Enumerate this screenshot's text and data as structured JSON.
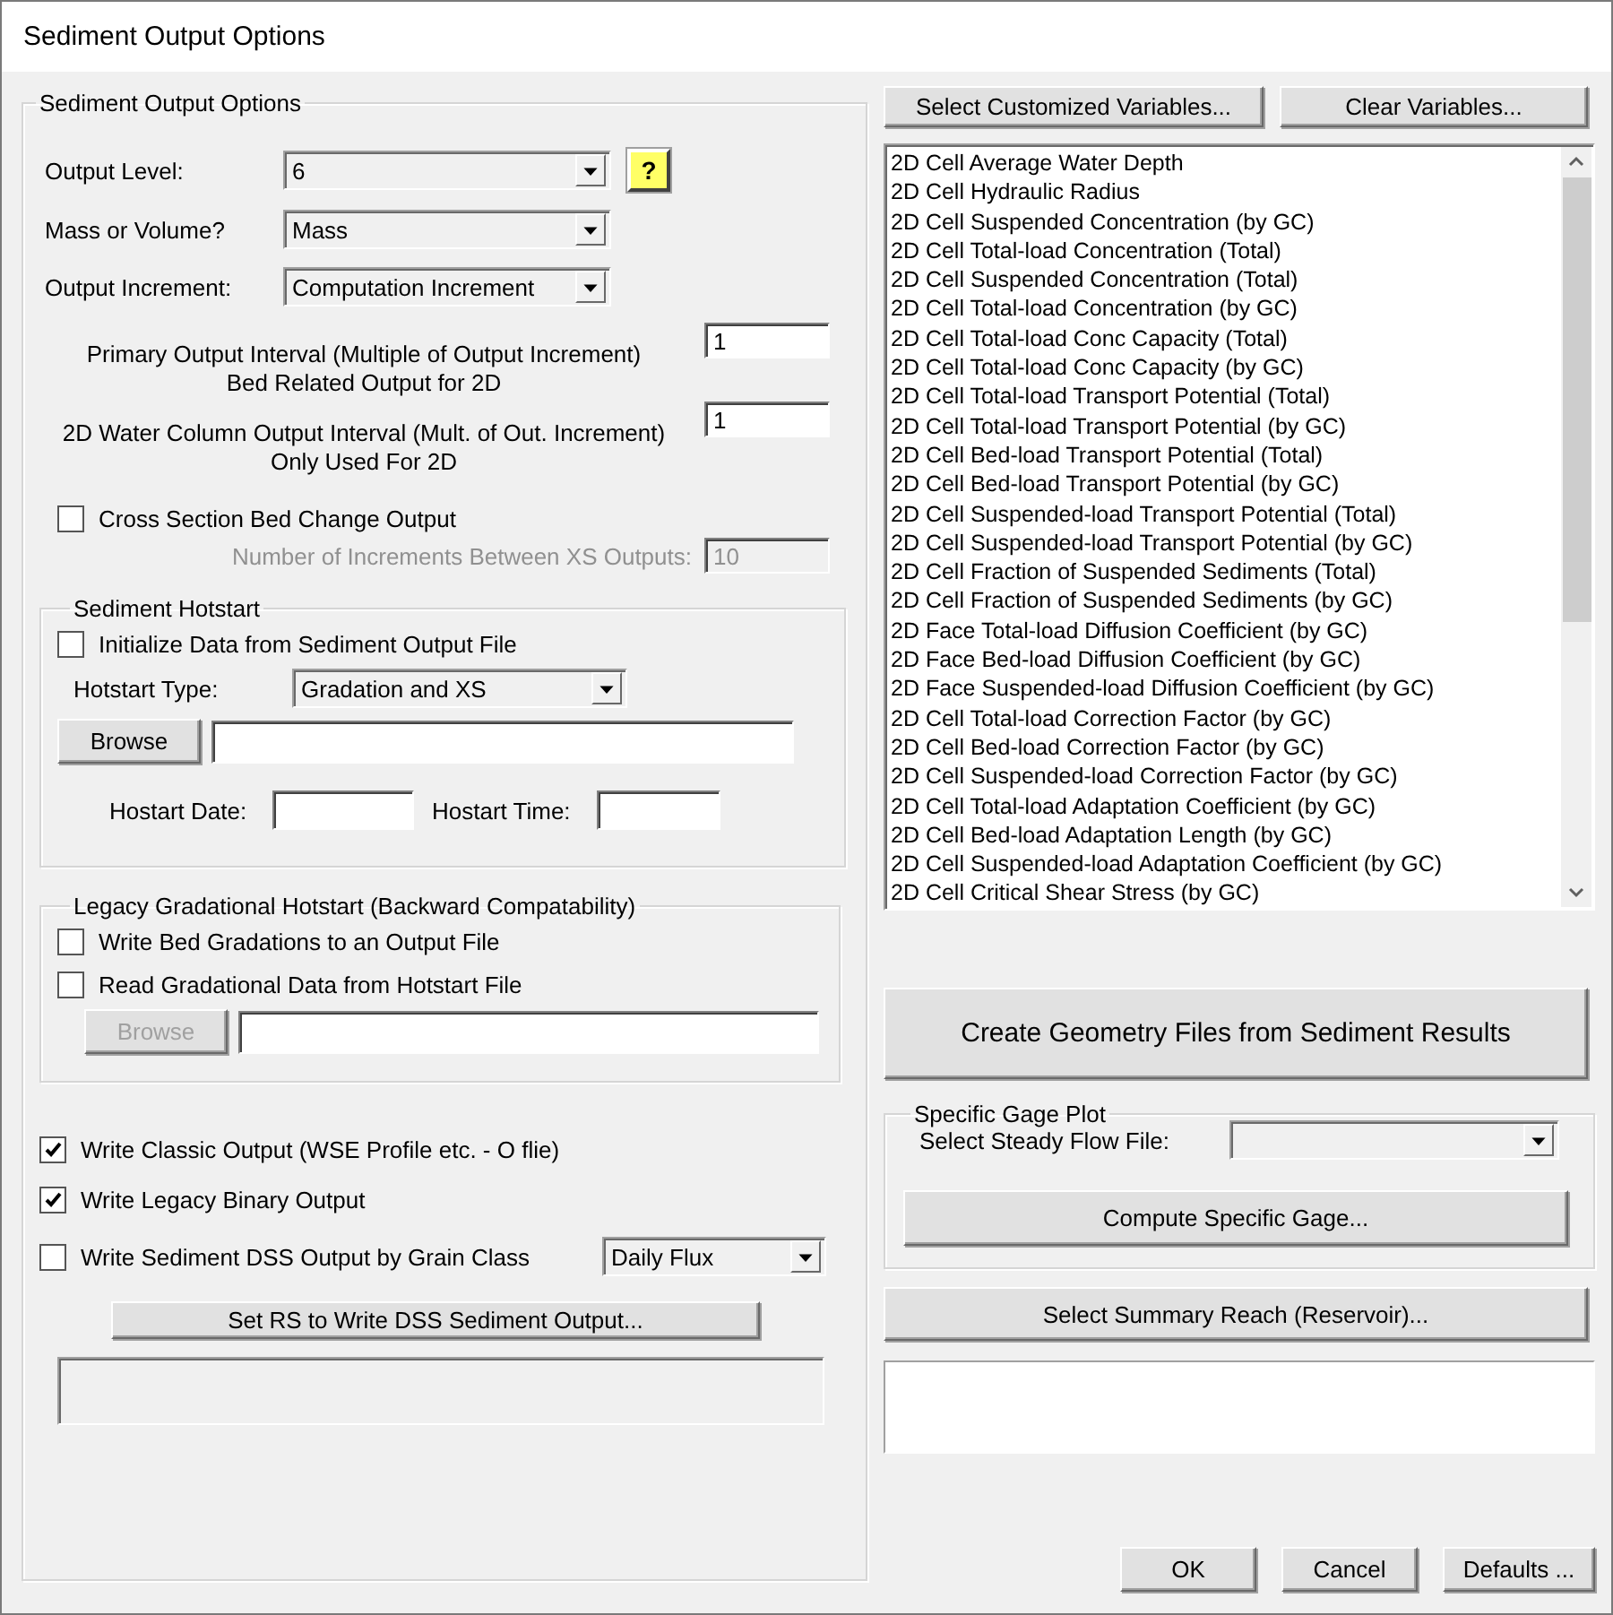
{
  "window": {
    "title": "Sediment Output Options"
  },
  "output_options": {
    "title": "Sediment Output Options",
    "output_level": {
      "label": "Output Level:",
      "value": "6",
      "help_button": "?"
    },
    "mass_or_volume": {
      "label": "Mass or Volume?",
      "value": "Mass"
    },
    "output_increment": {
      "label": "Output Increment:",
      "value": "Computation Increment"
    },
    "primary_interval": {
      "label_lines": [
        "Primary Output Interval (Multiple of Output Increment)",
        "Bed Related Output for 2D"
      ],
      "value": "1"
    },
    "water_column_interval": {
      "label_lines": [
        "2D Water Column Output Interval (Mult. of Out. Increment)",
        "Only Used For 2D"
      ],
      "value": "1"
    },
    "xs_bed_change": {
      "label": "Cross Section Bed Change Output",
      "checked": false
    },
    "xs_increments": {
      "label": "Number of Increments Between XS Outputs:",
      "value": "10",
      "disabled": true
    }
  },
  "hotstart": {
    "title": "Sediment Hotstart",
    "initialize": {
      "label": "Initialize Data from Sediment Output File",
      "checked": false
    },
    "type_label": "Hotstart Type:",
    "type_value": "Gradation and XS",
    "browse_button": "Browse",
    "date_label": "Hostart Date:",
    "time_label": "Hostart Time:"
  },
  "legacy_hotstart": {
    "title": "Legacy Gradational Hotstart (Backward Compatability)",
    "options": [
      {
        "label": "Write Bed Gradations to an Output File",
        "checked": false
      },
      {
        "label": "Read Gradational Data from Hotstart File",
        "checked": false
      }
    ],
    "browse_button": {
      "label": "Browse",
      "disabled": true
    }
  },
  "outputs": [
    {
      "label": "Write Classic Output (WSE Profile etc. - O flie)",
      "checked": true
    },
    {
      "label": "Write Legacy Binary Output",
      "checked": true
    },
    {
      "label": "Write Sediment DSS Output by Grain Class",
      "checked": false,
      "dropdown": "Daily Flux"
    }
  ],
  "set_rs_button": "Set RS to Write DSS Sediment Output...",
  "variable_buttons": [
    "Select Customized Variables...",
    "Clear Variables..."
  ],
  "variables": [
    "2D Cell Average Water Depth",
    "2D Cell Hydraulic Radius",
    "2D Cell Suspended Concentration (by GC)",
    "2D Cell Total-load Concentration (Total)",
    "2D Cell Suspended Concentration (Total)",
    "2D Cell Total-load Concentration (by GC)",
    "2D Cell Total-load Conc Capacity (Total)",
    "2D Cell Total-load Conc Capacity (by GC)",
    "2D Cell Total-load Transport Potential (Total)",
    "2D Cell Total-load Transport Potential (by GC)",
    "2D Cell Bed-load Transport Potential (Total)",
    "2D Cell Bed-load Transport Potential (by GC)",
    "2D Cell Suspended-load Transport Potential (Total)",
    "2D Cell Suspended-load Transport Potential (by GC)",
    "2D Cell Fraction of Suspended Sediments (Total)",
    "2D Cell Fraction of Suspended Sediments (by GC)",
    "2D Face Total-load Diffusion Coefficient (by GC)",
    "2D Face Bed-load Diffusion Coefficient (by GC)",
    "2D Face Suspended-load Diffusion Coefficient (by GC)",
    "2D Cell Total-load Correction Factor (by GC)",
    "2D Cell Bed-load Correction Factor (by GC)",
    "2D Cell Suspended-load Correction Factor (by GC)",
    "2D Cell Total-load Adaptation Coefficient (by GC)",
    "2D Cell Bed-load Adaptation Length (by GC)",
    "2D Cell Suspended-load Adaptation Coefficient (by GC)",
    "2D Cell Critical Shear Stress (by GC)"
  ],
  "create_geometry_button": "Create Geometry Files from Sediment Results",
  "specific_gage": {
    "title": "Specific Gage Plot",
    "flow_label": "Select Steady Flow File:",
    "compute_button": "Compute Specific Gage..."
  },
  "summary_reach_button": "Select Summary Reach (Reservoir)...",
  "dialog_buttons": [
    "OK",
    "Cancel",
    "Defaults ..."
  ]
}
